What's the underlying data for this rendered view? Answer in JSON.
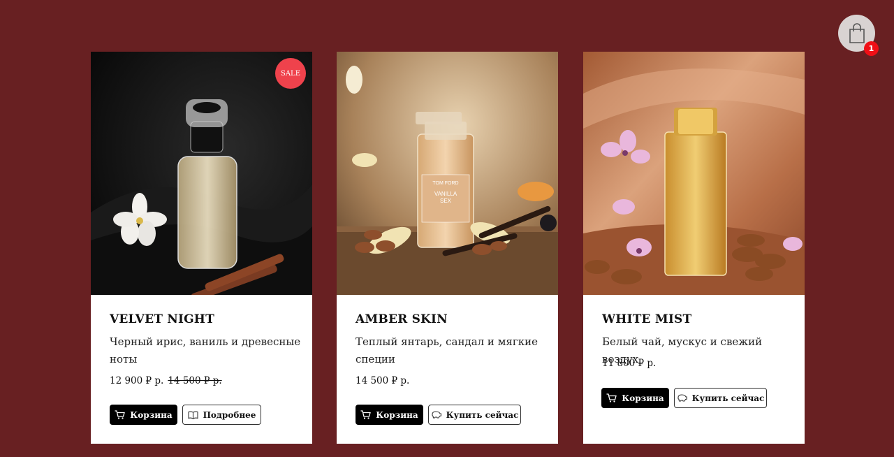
{
  "cart": {
    "count": "1"
  },
  "products": [
    {
      "name": "VELVET NIGHT",
      "description": "Черный ирис, ваниль и древесные ноты",
      "price": "12 900 ₽ р.",
      "old_price": "14 500 ₽ р.",
      "sale_label": "SALE",
      "primary_button": "Корзина",
      "secondary_button": "Подробнее"
    },
    {
      "name": "AMBER SKIN",
      "description": "Теплый янтарь, сандал и мягкие специи",
      "price": "14 500 ₽ р.",
      "bottle_label": "TOM FORD\nVANILLA\nSEX",
      "primary_button": "Корзина",
      "secondary_button": "Купить сейчас"
    },
    {
      "name": "WHITE MIST",
      "description": "Белый чай, мускус и свежий воздух",
      "price": "11 800 ₽ р.",
      "primary_button": "Корзина",
      "secondary_button": "Купить сейчас"
    }
  ],
  "colors": {
    "page_bg": "#682022",
    "sale": "#ef424c",
    "badge": "#f00f16"
  }
}
